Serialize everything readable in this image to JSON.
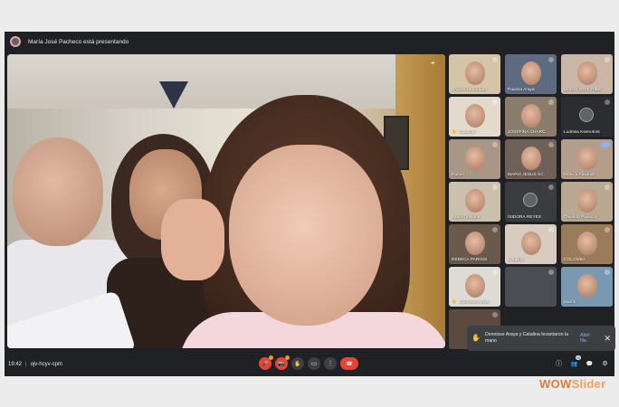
{
  "topbar": {
    "presenting_text": "María José Pacheco está presentando"
  },
  "tiles": [
    {
      "name": "Andrés Henríquez",
      "bg": "#d4c4a8"
    },
    {
      "name": "Paulina Araya",
      "bg": "#5d6a80"
    },
    {
      "name": "MARÍA JOSÉ RIBE",
      "bg": "#c9b6a6"
    },
    {
      "name": "Catalina",
      "bg": "#e3d9cc",
      "raised": true
    },
    {
      "name": "JOSEFINA CHARC",
      "bg": "#8b7d6e"
    },
    {
      "name": "Ludmila Ksenofont",
      "bg": "#2b2d30",
      "avatar": true
    },
    {
      "name": "Rafael",
      "bg": "#a89686"
    },
    {
      "name": "MARÍA JESÚS SC",
      "bg": "#6f6058"
    },
    {
      "name": "Mónica Alejandr",
      "bg": "#b59d8b",
      "active": true
    },
    {
      "name": "Fabio Orellana",
      "bg": "#cbbfae"
    },
    {
      "name": "ISIDORA REYES",
      "bg": "#3a3c40",
      "avatar": true
    },
    {
      "name": "Osvaldo Paolucci",
      "bg": "#b8a894"
    },
    {
      "name": "REBECA PARISSI",
      "bg": "#6a5a4c"
    },
    {
      "name": "Catalina",
      "bg": "#d8ccc0"
    },
    {
      "name": "COLOMBA",
      "bg": "#9a7c5c"
    },
    {
      "name": "Dennisse Araya",
      "bg": "#dedad4",
      "raised": true
    },
    {
      "name": "",
      "bg": "#4a4d52"
    },
    {
      "name": "Martín",
      "bg": "#7a98b0"
    },
    {
      "name": "",
      "bg": "#5a4a40"
    },
    {
      "name": "",
      "bg": "#3c4043"
    },
    {
      "name": "",
      "bg": "#3c4043"
    }
  ],
  "notification": {
    "text": "Dennisse Araya y Catalina levantaron la mano",
    "link": "Abrir fila",
    "close": "✕"
  },
  "bottombar": {
    "time": "19:42",
    "separator": "|",
    "meeting_code": "ojv-hcyv-cpm"
  },
  "controls": {
    "mic_icon": "🎤",
    "cam_icon": "📷",
    "hand_icon": "✋",
    "present_icon": "▭",
    "more_icon": "⋮",
    "end_icon": "☎"
  },
  "right_controls": {
    "info_icon": "ⓘ",
    "people_icon": "👥",
    "people_count": "30",
    "chat_icon": "💬",
    "activities_icon": "⚙"
  },
  "watermark": {
    "part1": "WOW",
    "part2": "Slider"
  },
  "colors": {
    "accent": "#8ab4f8",
    "end_call": "#ea4335",
    "warning": "#f29900",
    "bg_dark": "#202124"
  }
}
